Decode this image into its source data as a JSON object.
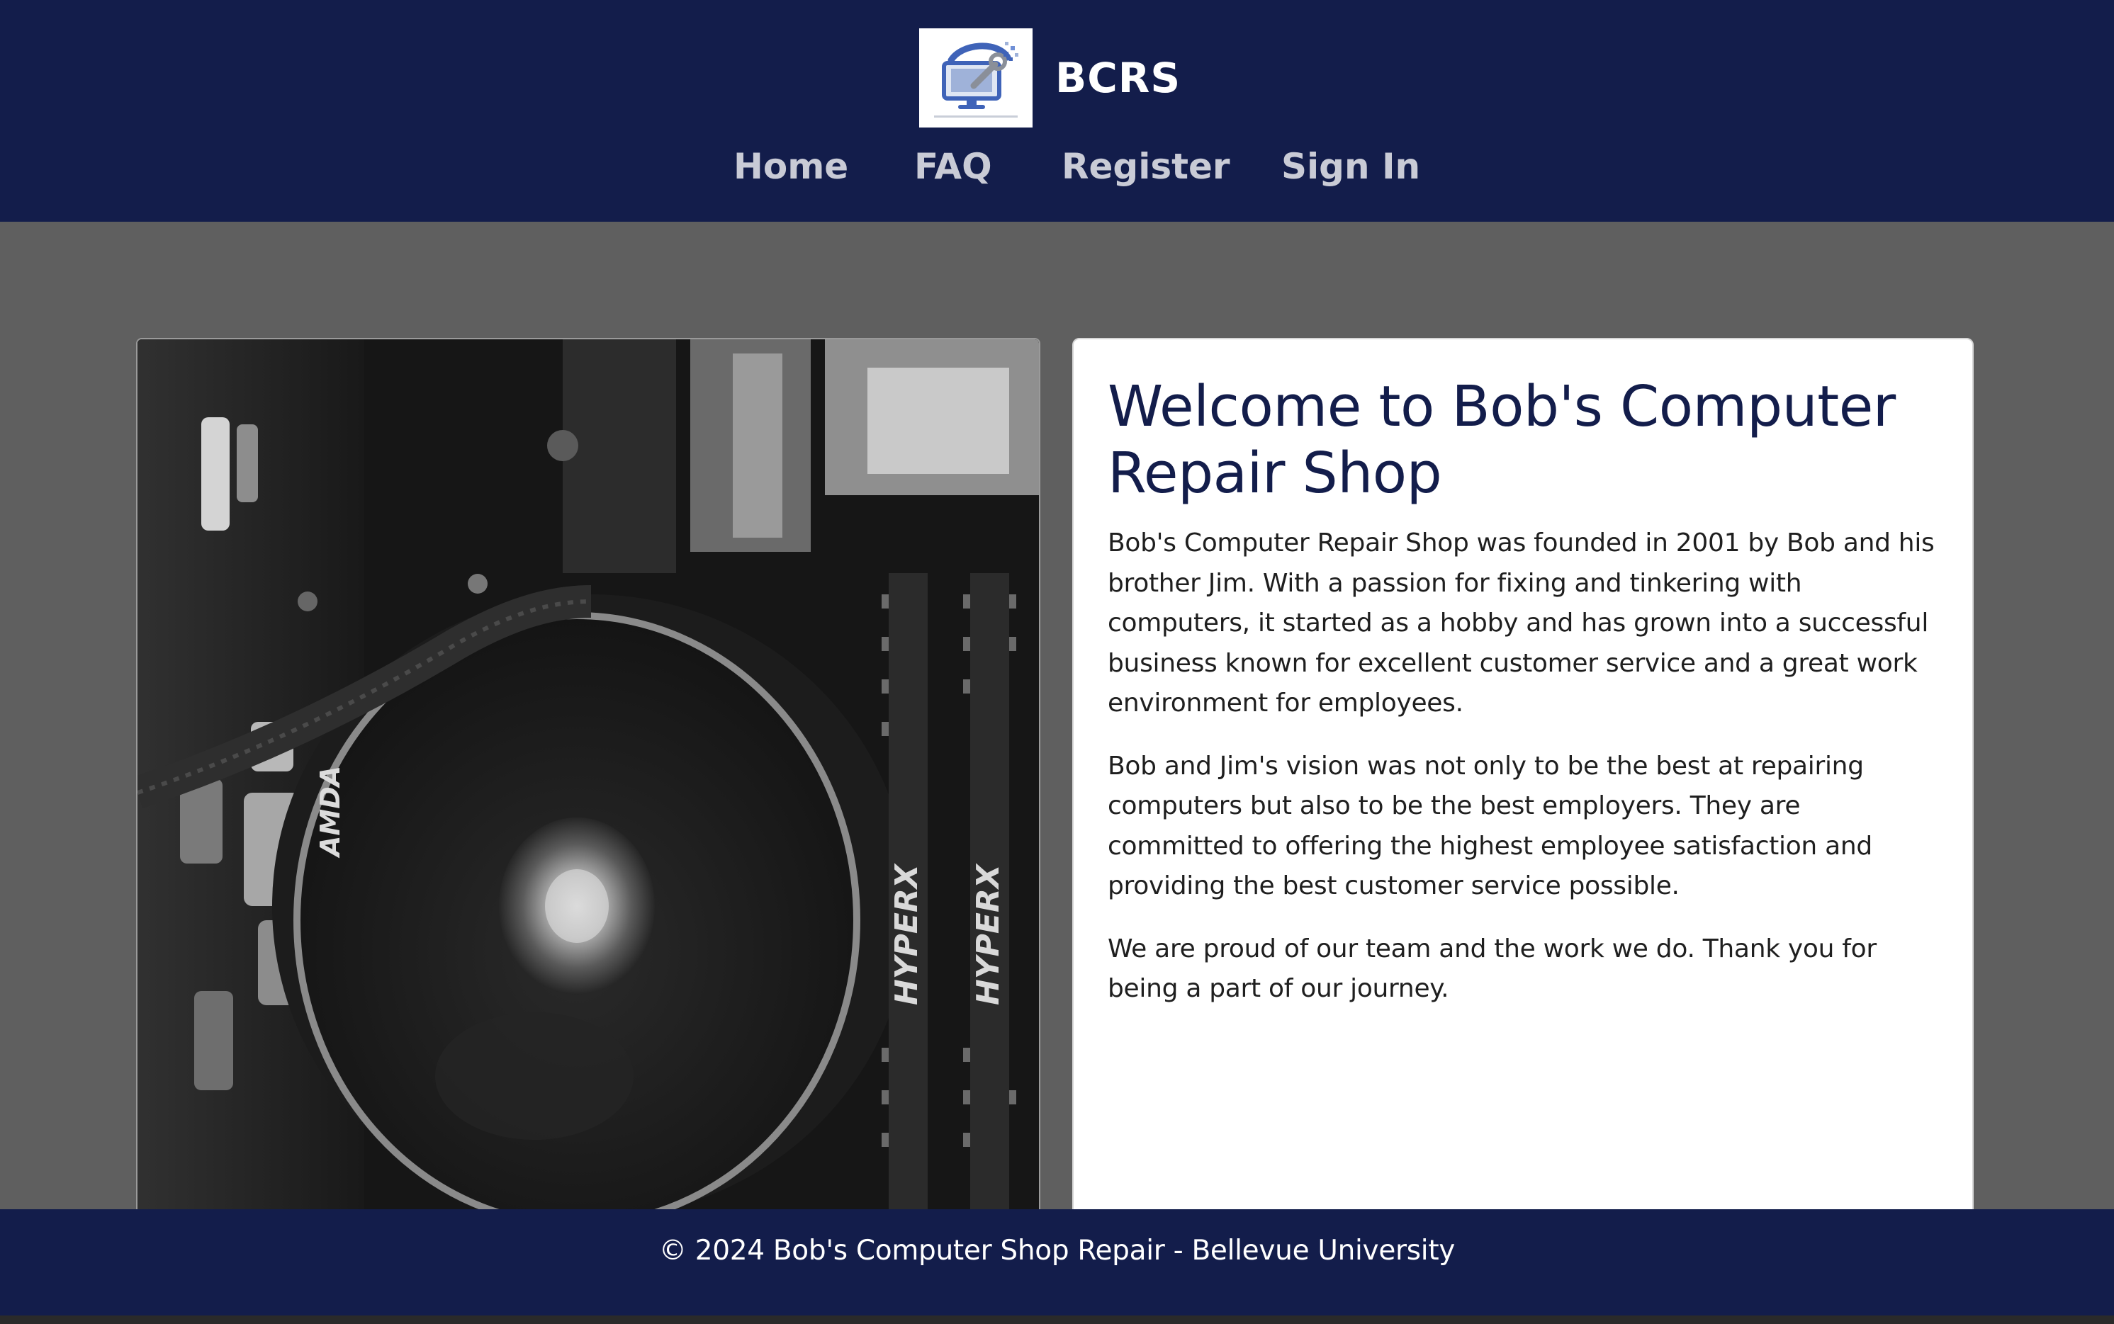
{
  "header": {
    "brand": "BCRS",
    "logo_icon": "computer-repair-logo-icon",
    "nav": [
      {
        "label": "Home"
      },
      {
        "label": "FAQ"
      },
      {
        "label": "Register"
      },
      {
        "label": "Sign In"
      }
    ]
  },
  "hero_image": {
    "icon": "pc-fan-photo",
    "text": {
      "brand_left": "AMDA",
      "module_1": "HYPERX",
      "module_2": "HYPERX"
    }
  },
  "main": {
    "title": "Welcome to Bob's Computer Repair Shop",
    "paragraphs": [
      "Bob's Computer Repair Shop was founded in 2001 by Bob and his brother Jim. With a passion for fixing and tinkering with computers, it started as a hobby and has grown into a successful business known for excellent customer service and a great work environment for employees.",
      "Bob and Jim's vision was not only to be the best at repairing computers but also to be the best employers. They are committed to offering the highest employee satisfaction and providing the best customer service possible.",
      "We are proud of our team and the work we do. Thank you for being a part of our journey."
    ]
  },
  "footer": {
    "text": "© 2024 Bob's Computer Shop Repair - Bellevue University"
  },
  "colors": {
    "header_bg": "#131d4b",
    "page_bg": "#5f5f5f",
    "title_color": "#131d4b",
    "nav_text": "#c9cbd6"
  }
}
